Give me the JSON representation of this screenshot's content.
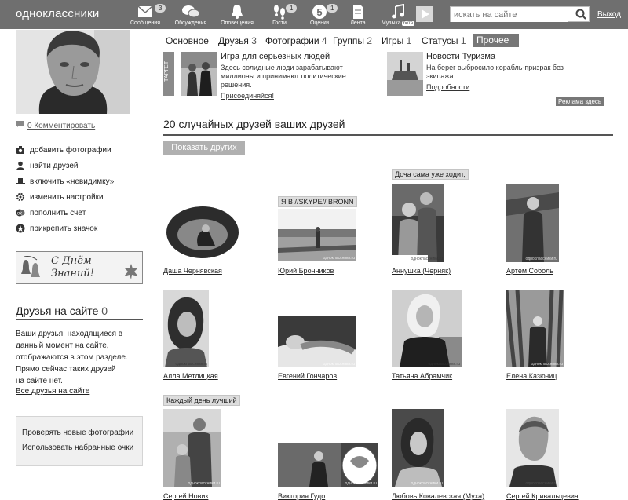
{
  "header": {
    "logo": "одноклассники",
    "nav": [
      {
        "label": "Сообщения",
        "badge": "3",
        "icon": "envelope-icon"
      },
      {
        "label": "Обсуждения",
        "badge": "",
        "icon": "chat-bubbles-icon"
      },
      {
        "label": "Оповещения",
        "badge": "",
        "icon": "bell-icon"
      },
      {
        "label": "Гости",
        "badge": "1",
        "icon": "footprints-icon"
      },
      {
        "label": "Оценки",
        "badge": "1",
        "icon": "rating-five-icon"
      },
      {
        "label": "Лента",
        "badge": "",
        "icon": "feed-icon"
      },
      {
        "label": "Музыка",
        "badge": "",
        "icon": "music-note-icon",
        "beta": "бета"
      }
    ],
    "search_placeholder": "искать на сайте",
    "logout": "Выход"
  },
  "sidebar": {
    "comment_link": "0 Комментировать",
    "actions": [
      {
        "label": "добавить фотографии",
        "icon": "camera-icon"
      },
      {
        "label": "найти друзей",
        "icon": "person-icon"
      },
      {
        "label": "включить «невидимку»",
        "icon": "hat-icon"
      },
      {
        "label": "изменить настройки",
        "icon": "gear-icon"
      },
      {
        "label": "пополнить счёт",
        "icon": "coins-icon"
      },
      {
        "label": "прикрепить значок",
        "icon": "badge-icon"
      }
    ],
    "banner": {
      "line1": "С Днём",
      "line2": "Знаний!"
    },
    "friends_online": {
      "title": "Друзья на сайте",
      "count": "0",
      "text_lines": [
        "Ваши друзья, находящиеся в",
        "данный момент на сайте,",
        "отображаются в этом разделе.",
        "Прямо сейчас таких друзей",
        "на сайте нет."
      ],
      "all_link": "Все друзья на сайте"
    },
    "links": [
      "Проверять новые фотографии",
      "Использовать набранные очки"
    ]
  },
  "tabs": [
    {
      "label": "Основное",
      "count": ""
    },
    {
      "label": "Друзья",
      "count": "3"
    },
    {
      "label": "Фотографии",
      "count": "4"
    },
    {
      "label": "Группы",
      "count": "2"
    },
    {
      "label": "Игры",
      "count": "1"
    },
    {
      "label": "Статусы",
      "count": "1"
    }
  ],
  "tab_more": "Прочее ▼",
  "ads": {
    "target_label": "ТАРГЕТ",
    "items": [
      {
        "title": "Игра для серьезных людей",
        "desc": "Здесь солидные люди зарабатывают миллионы и принимают политические решения.",
        "link": "Присоединяйся!"
      },
      {
        "title": "Новости Туризма",
        "desc": "На берег выбросило корабль-призрак без экипажа",
        "link": "Подробности"
      }
    ],
    "note": "Реклама здесь"
  },
  "section_title": "20 случайных друзей ваших друзей",
  "show_more": "Показать других",
  "watermark": "одноклассники.ru",
  "friends": [
    {
      "name": "Даша Чернявская",
      "status": ""
    },
    {
      "name": "Юрий Бронников",
      "status": "Я В //SKYPE// BRONN"
    },
    {
      "name": "Аннушка (Черняк)",
      "status": "Доча сама уже ходит,"
    },
    {
      "name": "Артем Соболь",
      "status": ""
    },
    {
      "name": "Алла Метлицкая",
      "status": ""
    },
    {
      "name": "Евгений Гончаров",
      "status": ""
    },
    {
      "name": "Татьяна Абрамчик",
      "status": ""
    },
    {
      "name": "Елена Казючиц",
      "status": ""
    },
    {
      "name": "Сергей Новик",
      "status": "Каждый день лучший"
    },
    {
      "name": "Виктория Гудо",
      "status": ""
    },
    {
      "name": "Любовь Ковалевская (Муха)",
      "status": ""
    },
    {
      "name": "Сергей Кривальцевич",
      "status": ""
    }
  ],
  "colors": {
    "topbar": "#6f6f6f",
    "accent": "#777777",
    "text": "#222222"
  }
}
